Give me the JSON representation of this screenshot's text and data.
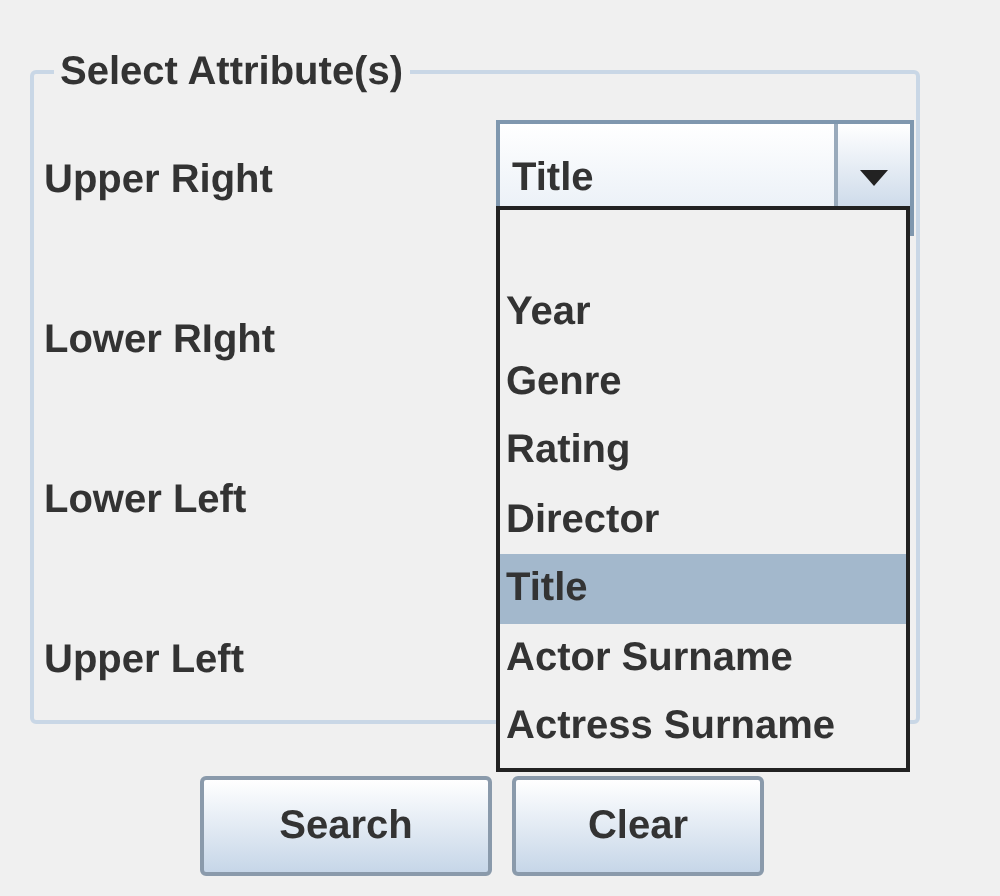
{
  "panel": {
    "title": "Select Attribute(s)",
    "rows": [
      {
        "label": "Upper Right"
      },
      {
        "label": "Lower RIght"
      },
      {
        "label": "Lower Left"
      },
      {
        "label": "Upper Left"
      }
    ],
    "combo": {
      "value": "Title",
      "expanded": true,
      "options": [
        {
          "label": "Year",
          "selected": false
        },
        {
          "label": "Genre",
          "selected": false
        },
        {
          "label": "Rating",
          "selected": false
        },
        {
          "label": "Director",
          "selected": false
        },
        {
          "label": "Title",
          "selected": true
        },
        {
          "label": "Actor Surname",
          "selected": false
        },
        {
          "label": "Actress Surname",
          "selected": false
        }
      ]
    }
  },
  "buttons": [
    {
      "label": "Search"
    },
    {
      "label": "Clear"
    }
  ]
}
